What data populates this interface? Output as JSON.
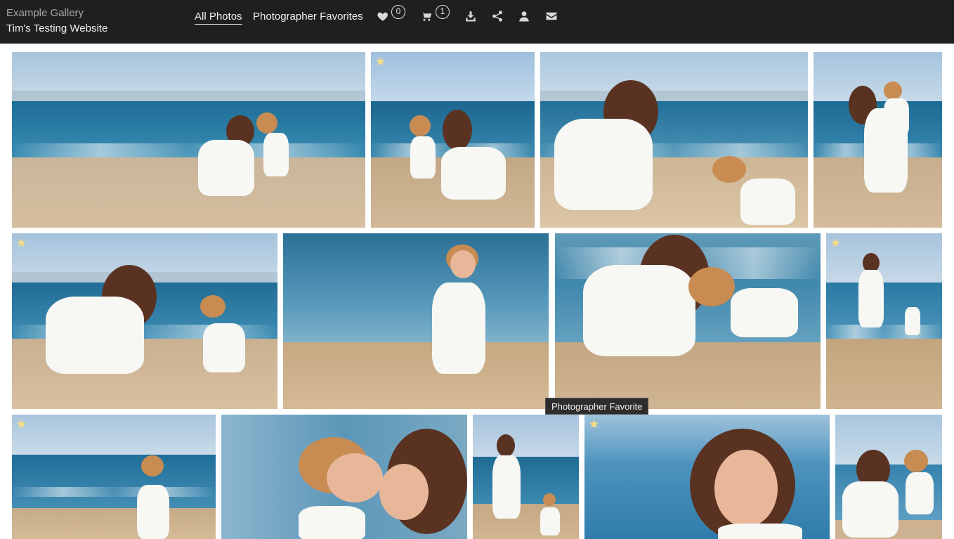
{
  "header": {
    "gallery_name": "Example Gallery",
    "site_name": "Tim's Testing Website",
    "nav": [
      {
        "label": "All Photos",
        "active": true
      },
      {
        "label": "Photographer Favorites",
        "active": false
      }
    ],
    "favorites_count": "0",
    "cart_count": "1",
    "icons": [
      "heart-icon",
      "cart-icon",
      "download-icon",
      "share-icon",
      "user-icon",
      "mail-icon"
    ]
  },
  "gallery": {
    "photos": [
      {
        "id": "photo-1",
        "favorite": false
      },
      {
        "id": "photo-2",
        "favorite": true
      },
      {
        "id": "photo-3",
        "favorite": false
      },
      {
        "id": "photo-4",
        "favorite": false
      },
      {
        "id": "photo-5",
        "favorite": true
      },
      {
        "id": "photo-6",
        "favorite": false
      },
      {
        "id": "photo-7",
        "favorite": false
      },
      {
        "id": "photo-8",
        "favorite": true
      },
      {
        "id": "photo-9",
        "favorite": true
      },
      {
        "id": "photo-10",
        "favorite": false
      },
      {
        "id": "photo-11",
        "favorite": false
      },
      {
        "id": "photo-12",
        "favorite": true
      },
      {
        "id": "photo-13",
        "favorite": false
      }
    ],
    "tooltip": "Photographer Favorite"
  },
  "colors": {
    "header_bg": "#1f1f1f",
    "star": "#f2dc86",
    "sky": "#b9d2e6",
    "sea": "#2c6f9a",
    "sand": "#cdb28f"
  }
}
